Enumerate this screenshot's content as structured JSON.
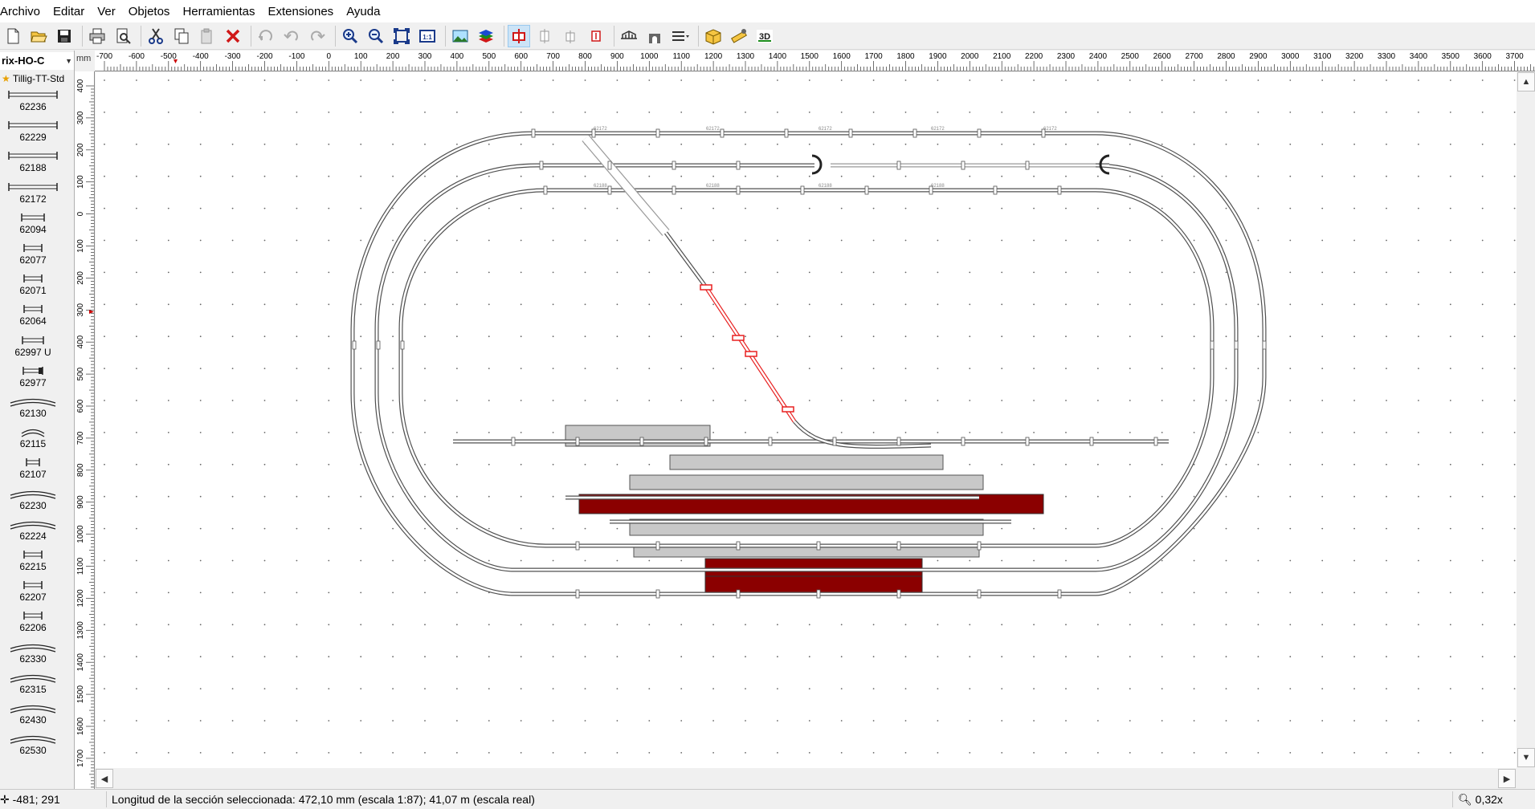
{
  "menu": [
    "Archivo",
    "Editar",
    "Ver",
    "Objetos",
    "Herramientas",
    "Extensiones",
    "Ayuda"
  ],
  "toolbar": {
    "buttons": [
      "new-file",
      "open-file",
      "save",
      "print",
      "print-preview",
      "cut",
      "copy",
      "paste",
      "delete",
      "redo-circle",
      "undo",
      "redo",
      "zoom-in",
      "zoom-out",
      "zoom-fit",
      "zoom-1-1",
      "background-image",
      "layers",
      "track-mode",
      "part-a",
      "part-b",
      "part-x",
      "bridge",
      "tunnel",
      "tracks",
      "3d-box",
      "measure",
      "3d-view"
    ],
    "zoom_1_1_label": "1:1",
    "view_3d_label": "3D"
  },
  "catalog": {
    "selected": "rix-HO-C",
    "sub": "Tillig-TT-Std",
    "items": [
      "62236",
      "62229",
      "62188",
      "62172",
      "62094",
      "62077",
      "62071",
      "62064",
      "62997 U",
      "62977",
      "62130",
      "62115",
      "62107",
      "62230",
      "62224",
      "62215",
      "62207",
      "62206",
      "62330",
      "62315",
      "62430",
      "62530"
    ]
  },
  "ruler": {
    "unit": "mm",
    "x_labels": [
      "-700",
      "-600",
      "-500",
      "-400",
      "-300",
      "-200",
      "-100",
      "0",
      "100",
      "200",
      "300",
      "400",
      "500",
      "600",
      "700",
      "800",
      "900",
      "1000",
      "1100",
      "1200",
      "1300",
      "1400",
      "1500",
      "1600",
      "1700",
      "1800",
      "1900",
      "2000",
      "2100",
      "2200",
      "2300",
      "2400",
      "2500",
      "2600",
      "2700",
      "2800",
      "2900",
      "3000",
      "3100",
      "3200",
      "3300",
      "3400",
      "3500",
      "3600",
      "3700"
    ],
    "y_labels": [
      "400",
      "300",
      "200",
      "100",
      "0",
      "100",
      "200",
      "300",
      "400",
      "500",
      "600",
      "700",
      "800",
      "900",
      "1000",
      "1100",
      "1200",
      "1300",
      "1400",
      "1500",
      "1600",
      "1700"
    ]
  },
  "layout_labels": {
    "straight_a": "62172",
    "straight_b": "62188",
    "straight_c": "62236"
  },
  "status": {
    "coords": "-481; 291",
    "message": "Longitud de la sección seleccionada: 472,10 mm (escala 1:87); 41,07 m (escala real)",
    "zoom": "0,32x"
  },
  "colors": {
    "selected_track": "#e82020",
    "platform_red": "#8b0000",
    "platform_gray": "#c8c8c8",
    "track_rail": "#505050"
  }
}
